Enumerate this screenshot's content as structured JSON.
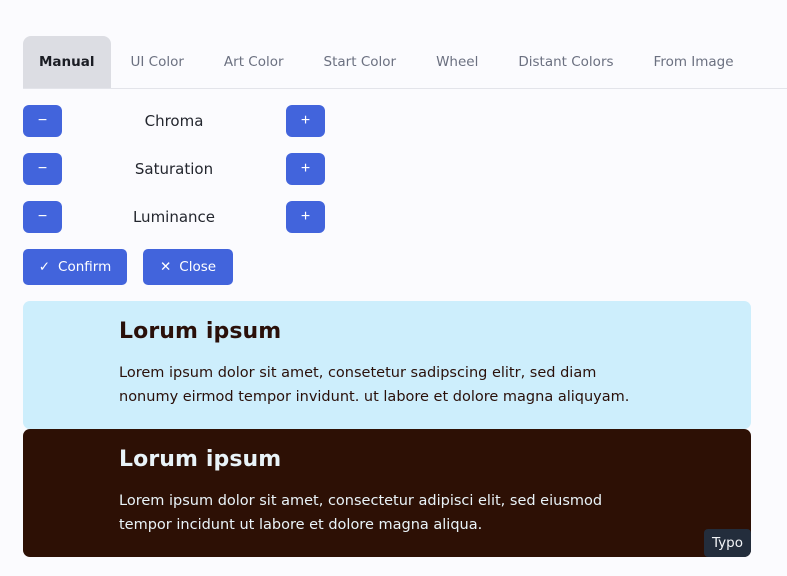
{
  "tabs": [
    {
      "label": "Manual",
      "active": true
    },
    {
      "label": "UI Color",
      "active": false
    },
    {
      "label": "Art Color",
      "active": false
    },
    {
      "label": "Start Color",
      "active": false
    },
    {
      "label": "Wheel",
      "active": false
    },
    {
      "label": "Distant Colors",
      "active": false
    },
    {
      "label": "From Image",
      "active": false
    }
  ],
  "adjusters": [
    {
      "label": "Chroma",
      "minus": "−",
      "plus": "+"
    },
    {
      "label": "Saturation",
      "minus": "−",
      "plus": "+"
    },
    {
      "label": "Luminance",
      "minus": "−",
      "plus": "+"
    }
  ],
  "actions": {
    "confirm_label": "Confirm",
    "confirm_icon": "✓",
    "close_label": "Close",
    "close_icon": "✕"
  },
  "preview_light": {
    "title": "Lorum ipsum",
    "body": "Lorem ipsum dolor sit amet, consetetur sadipscing elitr, sed diam nonumy eirmod tempor invidunt. ut labore et dolore magna aliquyam.",
    "background": "#cdeefc",
    "text_color": "#2a100a"
  },
  "preview_dark": {
    "title": "Lorum ipsum",
    "body": "Lorem ipsum dolor sit amet, consectetur adipisci elit, sed eiusmod tempor incidunt ut labore et dolore magna aliqua.",
    "background": "#2d1005",
    "text_color": "#e9f3f8"
  },
  "typo_button": "Typo",
  "colors": {
    "accent": "#4264dc",
    "tab_active_bg": "#dcdde3"
  }
}
